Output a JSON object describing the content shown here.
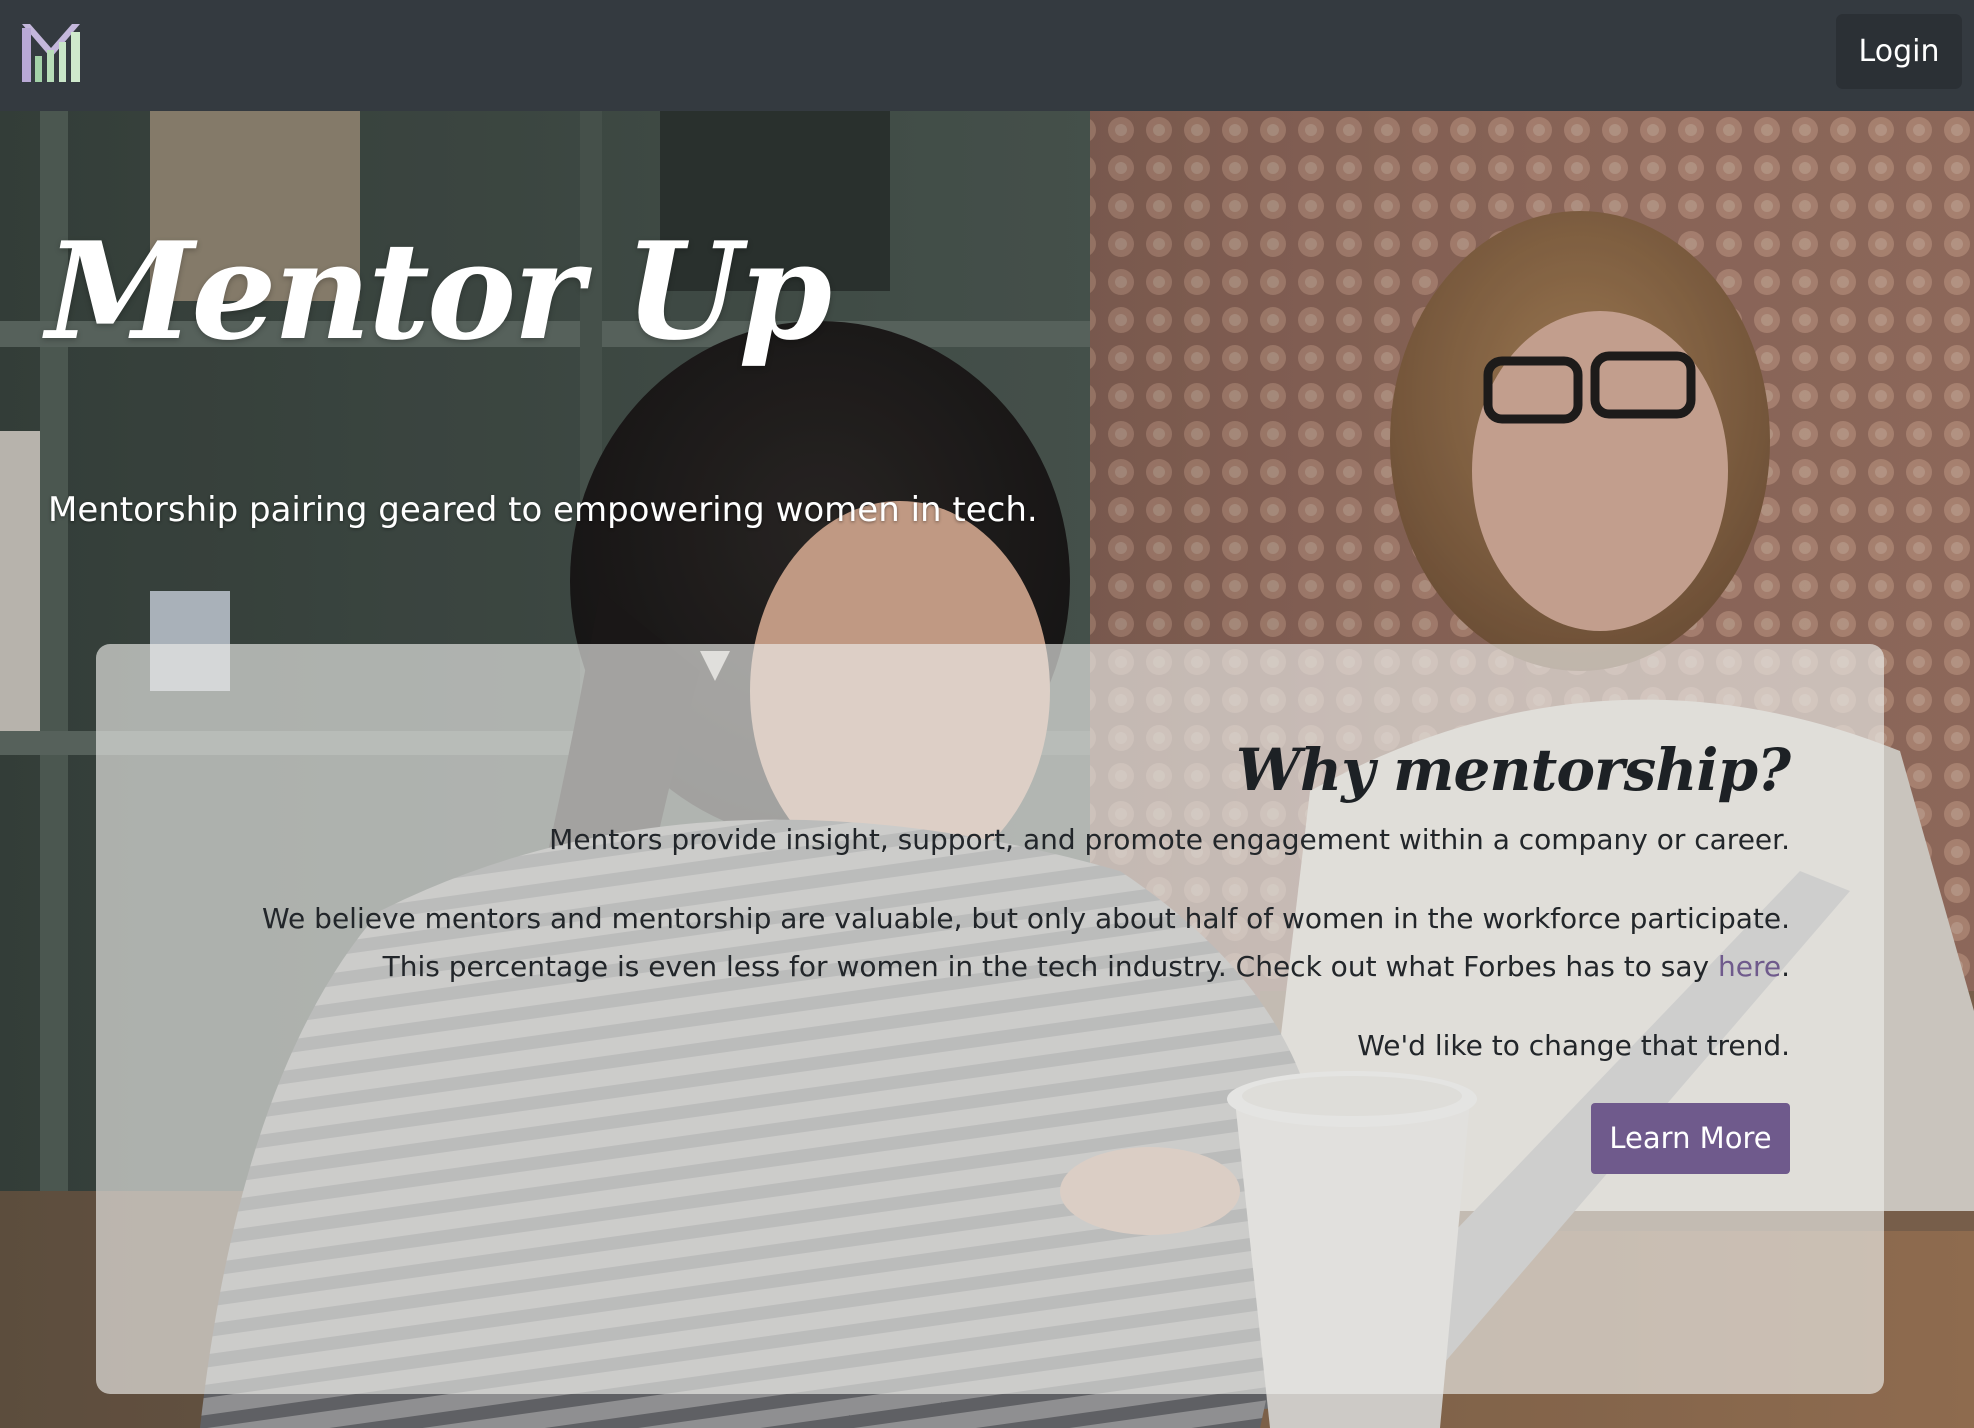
{
  "navbar": {
    "logo_icon": "mentor-up-m-logo-icon",
    "login_label": "Login"
  },
  "hero": {
    "title": "Mentor Up",
    "subtitle": "Mentorship pairing geared to empowering women in tech.",
    "background_image": "photo-two-women-working-on-laptop"
  },
  "card": {
    "heading": "Why mentorship?",
    "paragraph1": "Mentors provide insight, support, and promote engagement within a company or career.",
    "paragraph2_text": "We believe mentors and mentorship are valuable, but only about half of women in the workforce participate. This percentage is even less for women in the tech industry. Check out what Forbes has to say ",
    "paragraph2_link": "here",
    "paragraph2_end": ".",
    "paragraph3": "We'd like to change that trend.",
    "button_label": "Learn More"
  },
  "colors": {
    "navbar_bg": "#343a40",
    "login_bg": "#2b3035",
    "accent_purple": "#6f5a8c",
    "card_overlay": "rgba(235,235,232,0.66)"
  }
}
